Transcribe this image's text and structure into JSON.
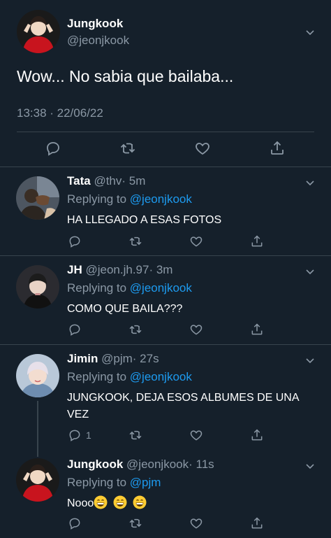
{
  "main_tweet": {
    "name": "Jungkook",
    "handle": "@jeonjkook",
    "text": "Wow... No sabia que bailaba...",
    "timestamp": "13:38 · 22/06/22"
  },
  "replies": [
    {
      "name": "Tata",
      "handle": "@thv",
      "time": "· 5m",
      "replying_prefix": "Replying to ",
      "replying_to": "@jeonjkook",
      "text": "HA LLEGADO A ESAS FOTOS",
      "reply_count": ""
    },
    {
      "name": "JH",
      "handle": "@jeon.jh.97",
      "time": "· 3m",
      "replying_prefix": "Replying to ",
      "replying_to": "@jeonjkook",
      "text": "COMO QUE BAILA???",
      "reply_count": ""
    },
    {
      "name": "Jimin",
      "handle": "@pjm",
      "time": "· 27s",
      "replying_prefix": "Replying to ",
      "replying_to": "@jeonjkook",
      "text": "JUNGKOOK, DEJA ESOS ALBUMES DE UNA VEZ",
      "reply_count": "1"
    },
    {
      "name": "Jungkook",
      "handle": "@jeonjkook",
      "time": "· 11s",
      "replying_prefix": "Replying to ",
      "replying_to": "@pjm",
      "text": "Nooo",
      "reply_count": ""
    }
  ],
  "icons": {
    "reply": "reply-icon",
    "retweet": "retweet-icon",
    "like": "heart-icon",
    "share": "share-icon",
    "more": "chevron-down-icon",
    "emoji": "grinning-emoji-icon"
  },
  "colors": {
    "background": "#15202b",
    "text": "#ffffff",
    "secondary": "#8b98a5",
    "link": "#1d9bf0",
    "divider": "#38444d"
  }
}
